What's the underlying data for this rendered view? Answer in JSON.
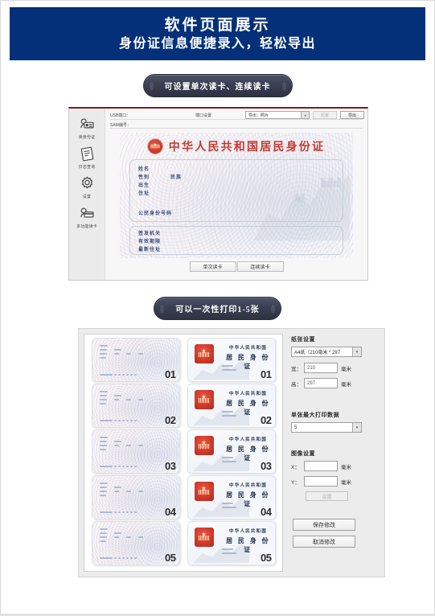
{
  "banner": {
    "title": "软件页面展示",
    "subtitle": "身份证信息便捷录入，轻松导出",
    "bg_color": "#033079"
  },
  "captions": {
    "caption_1": "可设置单次读卡、连续读卡",
    "caption_2": "可以一次性打印1-5张"
  },
  "reader_window": {
    "sidebar": [
      {
        "label": "读身份证",
        "icon": "id-card-reader-icon"
      },
      {
        "label": "日志查询",
        "icon": "log-document-icon"
      },
      {
        "label": "设置",
        "icon": "gear-icon"
      },
      {
        "label": "多功能读卡",
        "icon": "multi-card-reader-icon"
      }
    ],
    "toolbar": {
      "usb_port_label": "USB端口：",
      "sam_label": "SAM编号：",
      "port_settings": "端口设置",
      "export_select_value": "导出：照片",
      "config_button": "配置",
      "export_button": "导出"
    },
    "id_card": {
      "title": "中华人民共和国居民身份证",
      "emblem": "national-emblem-icon",
      "fields": [
        "姓名",
        "性别",
        "民族",
        "出生",
        "住址",
        "公民身份号码"
      ],
      "field_name": "姓名",
      "field_sex": "性别",
      "field_nation": "民族",
      "field_birth": "出生",
      "field_address": "住址",
      "field_id_number": "公民身份号码",
      "back_fields": [
        "签发机关",
        "有效期限",
        "最新住址"
      ],
      "field_issuer": "签发机关",
      "field_validity": "有效期限",
      "field_new_address": "最新住址"
    },
    "buttons": {
      "single_read": "单次读卡",
      "continuous_read": "连续读卡"
    }
  },
  "print_window": {
    "cards": [
      {
        "no": "01"
      },
      {
        "no": "02"
      },
      {
        "no": "03"
      },
      {
        "no": "04"
      },
      {
        "no": "05"
      }
    ],
    "card_back": {
      "line1": "中华人民共和国",
      "line2": "居 民 身 份 证"
    },
    "settings": {
      "paper_title": "纸张设置",
      "paper_value": "A4纸（210毫米 * 297",
      "width_label": "宽：",
      "width_value": "210",
      "height_label": "高：",
      "height_value": "297",
      "unit": "毫米",
      "max_title": "单张最大打印数据",
      "max_value": "5",
      "image_title": "图像设置",
      "x_label": "X：",
      "x_value": "",
      "y_label": "Y：",
      "y_value": "",
      "set_button": "设置",
      "save_button": "保存修改",
      "cancel_button": "取消修改"
    }
  }
}
